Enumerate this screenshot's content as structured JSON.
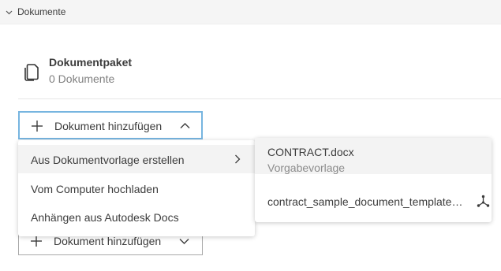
{
  "section": {
    "title": "Dokumente"
  },
  "package": {
    "title": "Dokumentpaket",
    "count_text": "0 Dokumente"
  },
  "add_button": {
    "label": "Dokument hinzufügen"
  },
  "menu": {
    "items": [
      {
        "label": "Aus Dokumentvorlage erstellen"
      },
      {
        "label": "Vom Computer hochladen"
      },
      {
        "label": "Anhängen aus Autodesk Docs"
      }
    ]
  },
  "submenu": {
    "templates": [
      {
        "name": "CONTRACT.docx",
        "description": "Vorgabevorlage"
      },
      {
        "name": "contract_sample_document_template.docx"
      }
    ]
  },
  "colors": {
    "focus_border": "#77b5e0",
    "hover_bg": "#f3f3f3",
    "header_bg": "#f5f5f5"
  }
}
